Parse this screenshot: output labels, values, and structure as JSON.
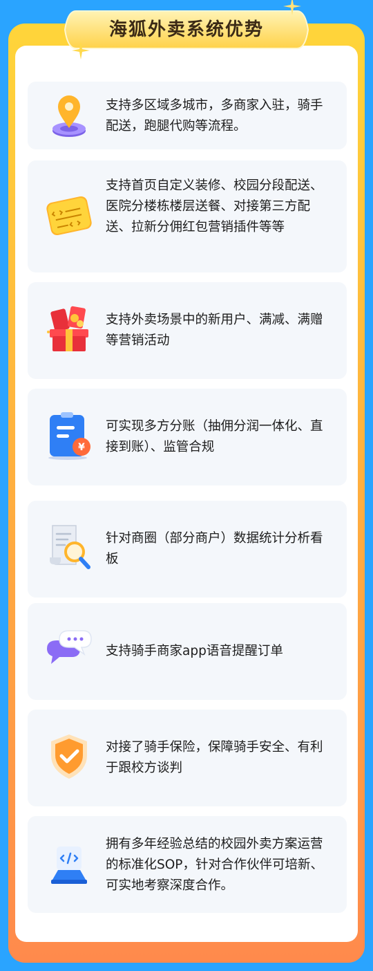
{
  "title": "海狐外卖系统优势",
  "colors": {
    "background": "#2aa4ff",
    "frame_top": "#ffd53a",
    "frame_bottom": "#ff8a4c",
    "card": "#f4f7fb",
    "title_banner": "#ffe07a"
  },
  "features": [
    {
      "icon": "location-pin-icon",
      "text": "支持多区域多城市，多商家入驻，骑手配送，跑腿代购等流程。"
    },
    {
      "icon": "code-note-icon",
      "text": "支持首页自定义装修、校园分段配送、医院分楼栋楼层送餐、对接第三方配送、拉新分佣红包营销插件等等"
    },
    {
      "icon": "gift-box-icon",
      "text": "支持外卖场景中的新用户、满减、满赠等营销活动"
    },
    {
      "icon": "bill-yuan-icon",
      "text": "可实现多方分账（抽佣分润一体化、直接到账）、监管合规"
    },
    {
      "icon": "scroll-magnifier-icon",
      "text": "针对商圈（部分商户）数据统计分析看板"
    },
    {
      "icon": "chat-bubbles-icon",
      "text": "支持骑手商家app语音提醒订单"
    },
    {
      "icon": "shield-check-icon",
      "text": "对接了骑手保险，保障骑手安全、有利于跟校方谈判"
    },
    {
      "icon": "code-monitor-icon",
      "text": "拥有多年经验总结的校园外卖方案运营的标准化SOP，针对合作伙伴可培新、可实地考察深度合作。"
    }
  ]
}
